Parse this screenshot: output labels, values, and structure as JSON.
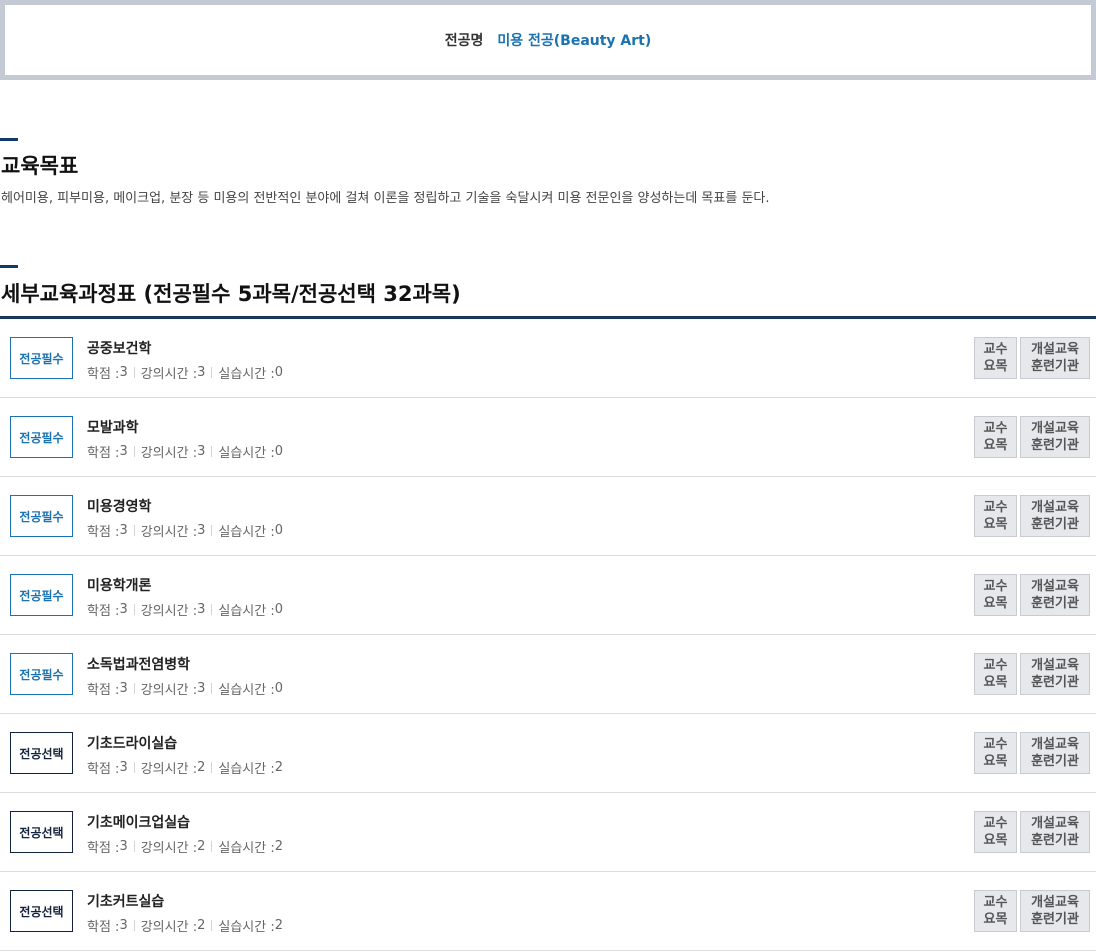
{
  "major": {
    "label": "전공명",
    "value": "미용 전공(Beauty Art)"
  },
  "goal": {
    "title": "교육목표",
    "text": "헤어미용, 피부미용, 메이크업, 분장 등 미용의 전반적인 분야에 걸쳐 이론을 정립하고 기술을 숙달시켜 미용 전문인을 양성하는데 목표를 둔다."
  },
  "curriculum": {
    "title": "세부교육과정표 (전공필수 5과목/전공선택 32과목)"
  },
  "meta_labels": {
    "credit": "학점 : ",
    "lecture": "강의시간 : ",
    "practice": "실습시간 : "
  },
  "buttons": {
    "professor_line1": "교수",
    "professor_line2": "요목",
    "institution_line1": "개설교육",
    "institution_line2": "훈련기관"
  },
  "courses": [
    {
      "type": "전공필수",
      "kind": "required",
      "name": "공중보건학",
      "credit": "3",
      "lecture": "3",
      "practice": "0"
    },
    {
      "type": "전공필수",
      "kind": "required",
      "name": "모발과학",
      "credit": "3",
      "lecture": "3",
      "practice": "0"
    },
    {
      "type": "전공필수",
      "kind": "required",
      "name": "미용경영학",
      "credit": "3",
      "lecture": "3",
      "practice": "0"
    },
    {
      "type": "전공필수",
      "kind": "required",
      "name": "미용학개론",
      "credit": "3",
      "lecture": "3",
      "practice": "0"
    },
    {
      "type": "전공필수",
      "kind": "required",
      "name": "소독법과전염병학",
      "credit": "3",
      "lecture": "3",
      "practice": "0"
    },
    {
      "type": "전공선택",
      "kind": "elective",
      "name": "기초드라이실습",
      "credit": "3",
      "lecture": "2",
      "practice": "2"
    },
    {
      "type": "전공선택",
      "kind": "elective",
      "name": "기초메이크업실습",
      "credit": "3",
      "lecture": "2",
      "practice": "2"
    },
    {
      "type": "전공선택",
      "kind": "elective",
      "name": "기초커트실습",
      "credit": "3",
      "lecture": "2",
      "practice": "2"
    }
  ],
  "colors": {
    "accent": "#1a72b0",
    "navy": "#14233d",
    "border": "#c4cad3"
  }
}
